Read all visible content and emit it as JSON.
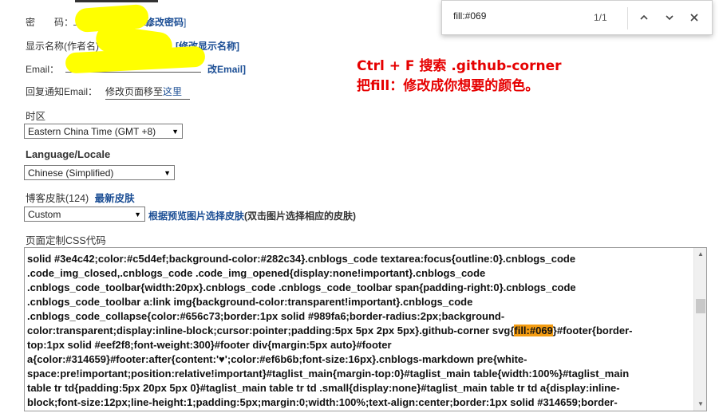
{
  "form": {
    "password_label": "密　　码：",
    "password_link": "修改密码",
    "display_name_label": "显示名称(作者名)",
    "display_name_link": "[修改显示名称]",
    "email_label": "Email：",
    "email_link": "改Email]",
    "reply_email_label": "回复通知Email：",
    "reply_email_text": "修改页面移至",
    "reply_email_link": "这里"
  },
  "annotation": {
    "line1": "Ctrl + F 搜索 .github-corner",
    "line2": "把fill：修改成你想要的颜色。"
  },
  "timezone": {
    "label": "时区",
    "value": "Eastern China Time (GMT +8)"
  },
  "language": {
    "label": "Language/Locale",
    "value": "Chinese (Simplified)"
  },
  "skin": {
    "label": "博客皮肤(124)",
    "new_link": "最新皮肤",
    "value": "Custom",
    "preview_link": "根据预览图片选择皮肤",
    "hint": "(双击图片选择相应的皮肤)"
  },
  "css_editor": {
    "label": "页面定制CSS代码",
    "lines": [
      "solid #3e4c42;color:#c5d4ef;background-color:#282c34}.cnblogs_code textarea:focus{outline:0}.cnblogs_code",
      ".code_img_closed,.cnblogs_code .code_img_opened{display:none!important}.cnblogs_code",
      ".cnblogs_code_toolbar{width:20px}.cnblogs_code .cnblogs_code_toolbar span{padding-right:0}.cnblogs_code",
      ".cnblogs_code_toolbar a:link img{background-color:transparent!important}.cnblogs_code",
      ".cnblogs_code_collapse{color:#656c73;border:1px solid #989fa6;border-radius:2px;background-",
      "#footer{border-",
      "top:1px solid #eef2f8;font-weight:300}#footer div{margin:5px auto}#footer",
      "a{color:#314659}#footer:after{content:'♥';color:#ef6b6b;font-size:16px}.cnblogs-markdown pre{white-",
      "space:pre!important;position:relative!important}#taglist_main{margin-top:0}#taglist_main table{width:100%}#taglist_main",
      "table tr td{padding:5px 20px 5px 0}#taglist_main table tr td .small{display:none}#taglist_main table tr td a{display:inline-",
      "block;font-size:12px;line-height:1;padding:5px;margin:0;width:100%;text-align:center;border:1px solid #314659;border-"
    ],
    "line6_prefix": "color:transparent;display:inline-block;cursor:pointer;padding:5px 5px 2px 5px}.github-corner svg{",
    "highlight": "fill:#069",
    "highlight_color": "#f39c12"
  },
  "find_bar": {
    "query": "fill:#069",
    "count": "1/1"
  },
  "colors": {
    "link": "#1a4d94",
    "annotation": "#e60000",
    "redaction": "#ffff00"
  }
}
